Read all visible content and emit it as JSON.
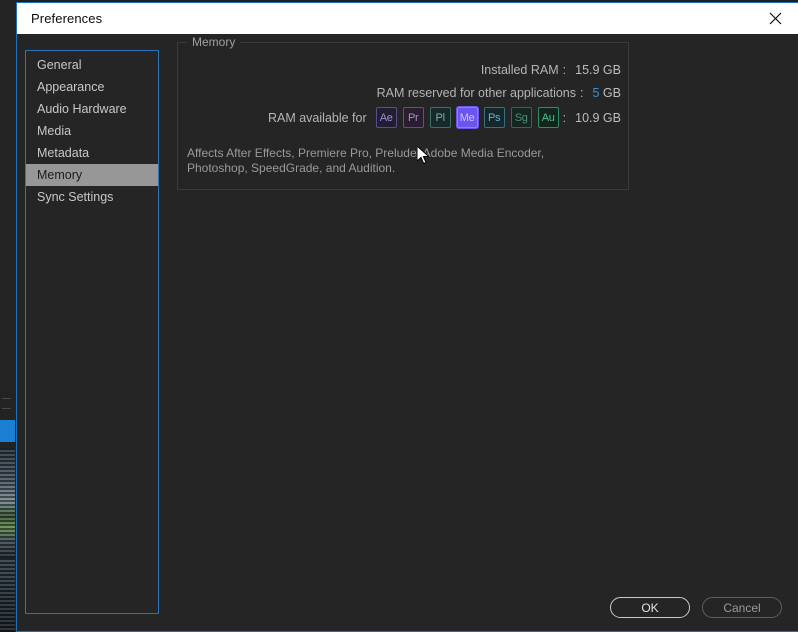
{
  "window": {
    "title": "Preferences",
    "close_icon": "close-icon"
  },
  "sidebar": {
    "items": [
      {
        "label": "General",
        "selected": false
      },
      {
        "label": "Appearance",
        "selected": false
      },
      {
        "label": "Audio Hardware",
        "selected": false
      },
      {
        "label": "Media",
        "selected": false
      },
      {
        "label": "Metadata",
        "selected": false
      },
      {
        "label": "Memory",
        "selected": true
      },
      {
        "label": "Sync Settings",
        "selected": false
      }
    ]
  },
  "memory": {
    "group_title": "Memory",
    "installed": {
      "label": "Installed RAM",
      "colon": ":",
      "value": "15.9 GB"
    },
    "reserved": {
      "label": "RAM reserved for other applications",
      "colon": ":",
      "value_num": "5",
      "value_unit": " GB"
    },
    "available": {
      "label": "RAM available for",
      "colon": ":",
      "value": "10.9 GB"
    },
    "app_icons": [
      {
        "name": "after-effects-icon",
        "abbr": "Ae",
        "fg": "#9a8fd6",
        "border": "#5b4f87",
        "bg": "#221d33",
        "selected": false
      },
      {
        "name": "premiere-pro-icon",
        "abbr": "Pr",
        "fg": "#b48ac9",
        "border": "#6d4a7d",
        "bg": "#2a1d30",
        "selected": false
      },
      {
        "name": "prelude-icon",
        "abbr": "Pl",
        "fg": "#6fb8a8",
        "border": "#3f6f65",
        "bg": "#18292a",
        "selected": false
      },
      {
        "name": "media-encoder-icon",
        "abbr": "Me",
        "fg": "#cfc4ff",
        "border": "#8f7dff",
        "bg": "#6a55ee",
        "selected": true
      },
      {
        "name": "photoshop-icon",
        "abbr": "Ps",
        "fg": "#64b5cf",
        "border": "#3a6f80",
        "bg": "#15262c",
        "selected": false
      },
      {
        "name": "speedgrade-icon",
        "abbr": "Sg",
        "fg": "#4f8f74",
        "border": "#356553",
        "bg": "#152622",
        "selected": false
      },
      {
        "name": "audition-icon",
        "abbr": "Au",
        "fg": "#49c08a",
        "border": "#2f8f63",
        "bg": "#12261e",
        "selected": false
      }
    ],
    "note": "Affects After Effects, Premiere Pro, Prelude, Adobe Media Encoder, Photoshop, SpeedGrade, and Audition."
  },
  "footer": {
    "ok_label": "OK",
    "cancel_label": "Cancel"
  },
  "colors": {
    "accent_blue": "#2c72b8",
    "hot_text": "#3b8fde",
    "selection_gray": "#979797",
    "dialog_bg": "#252525",
    "titlebar_bg": "#ffffff"
  }
}
